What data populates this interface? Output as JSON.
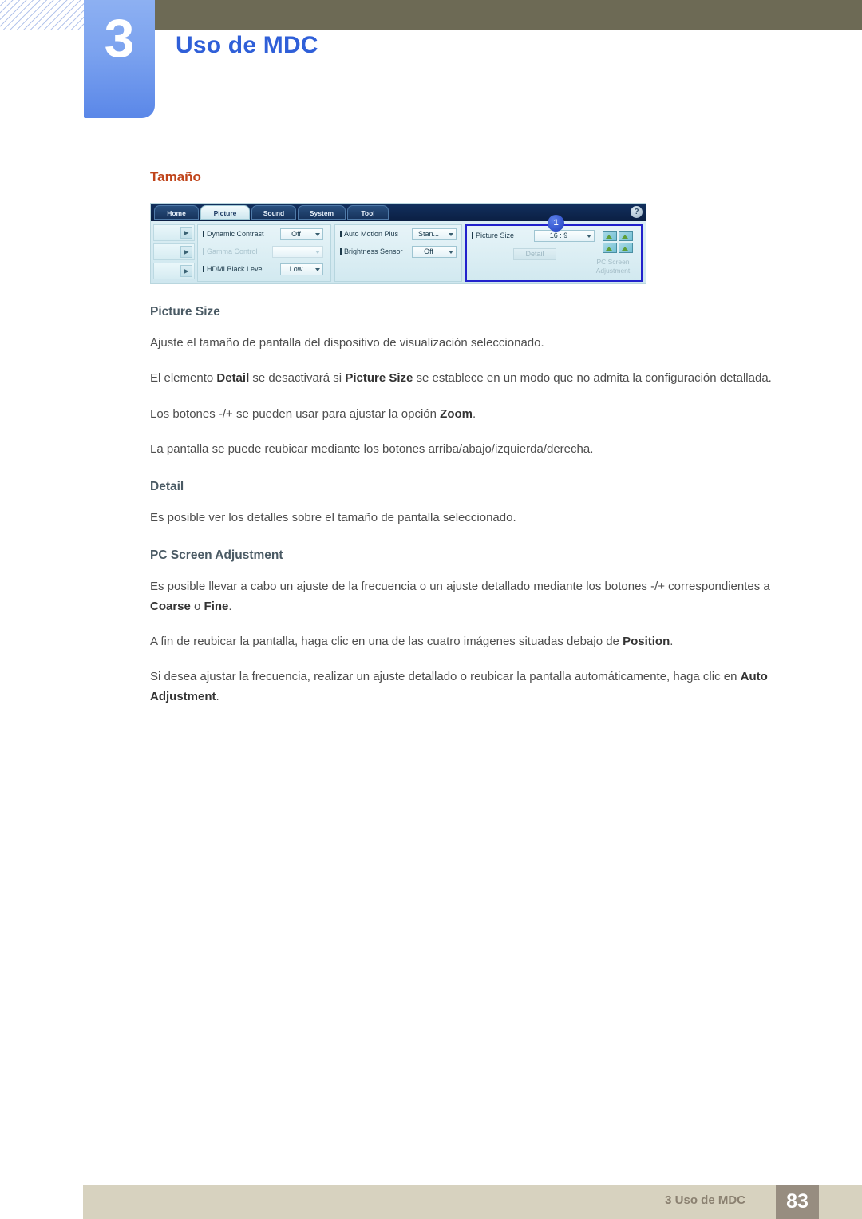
{
  "header": {
    "chapter_number": "3",
    "chapter_title": "Uso de MDC"
  },
  "content": {
    "section_heading": "Tamaño",
    "blocks": [
      {
        "type": "subheading",
        "text": "Picture Size"
      },
      {
        "type": "paragraph",
        "text": "Ajuste el tamaño de pantalla del dispositivo de visualización seleccionado."
      },
      {
        "type": "paragraph_rich",
        "parts": [
          {
            "t": "El elemento ",
            "b": false
          },
          {
            "t": "Detail",
            "b": true
          },
          {
            "t": " se desactivará si ",
            "b": false
          },
          {
            "t": "Picture Size",
            "b": true
          },
          {
            "t": " se establece en un modo que no admita la configuración detallada.",
            "b": false
          }
        ]
      },
      {
        "type": "paragraph_rich",
        "parts": [
          {
            "t": "Los botones -/+ se pueden usar para ajustar la opción ",
            "b": false
          },
          {
            "t": "Zoom",
            "b": true
          },
          {
            "t": ".",
            "b": false
          }
        ]
      },
      {
        "type": "paragraph",
        "text": "La pantalla se puede reubicar mediante los botones arriba/abajo/izquierda/derecha."
      },
      {
        "type": "subheading",
        "text": "Detail"
      },
      {
        "type": "paragraph",
        "text": "Es posible ver los detalles sobre el tamaño de pantalla seleccionado."
      },
      {
        "type": "subheading",
        "text": "PC Screen Adjustment"
      },
      {
        "type": "paragraph_rich",
        "parts": [
          {
            "t": "Es posible llevar a cabo un ajuste de la frecuencia o un ajuste detallado mediante los botones -/+ correspondientes a ",
            "b": false
          },
          {
            "t": "Coarse",
            "b": true
          },
          {
            "t": " o ",
            "b": false
          },
          {
            "t": "Fine",
            "b": true
          },
          {
            "t": ".",
            "b": false
          }
        ]
      },
      {
        "type": "paragraph_rich",
        "parts": [
          {
            "t": "A fin de reubicar la pantalla, haga clic en una de las cuatro imágenes situadas debajo de ",
            "b": false
          },
          {
            "t": "Position",
            "b": true
          },
          {
            "t": ".",
            "b": false
          }
        ]
      },
      {
        "type": "paragraph_rich",
        "parts": [
          {
            "t": "Si desea ajustar la frecuencia, realizar un ajuste detallado o reubicar la pantalla automáticamente, haga clic en ",
            "b": false
          },
          {
            "t": "Auto Adjustment",
            "b": true
          },
          {
            "t": ".",
            "b": false
          }
        ]
      }
    ]
  },
  "mdc_screenshot": {
    "tabs": [
      {
        "label": "Home",
        "active": false
      },
      {
        "label": "Picture",
        "active": true
      },
      {
        "label": "Sound",
        "active": false
      },
      {
        "label": "System",
        "active": false
      },
      {
        "label": "Tool",
        "active": false
      }
    ],
    "help_icon": "?",
    "callout_badge": "1",
    "group1": [
      {
        "label": "Dynamic Contrast",
        "value": "Off",
        "disabled": false
      },
      {
        "label": "Gamma Control",
        "value": "",
        "disabled": true
      },
      {
        "label": "HDMI Black Level",
        "value": "Low",
        "disabled": false
      }
    ],
    "group2": [
      {
        "label": "Auto Motion Plus",
        "value": "Stan...",
        "disabled": false
      },
      {
        "label": "Brightness Sensor",
        "value": "Off",
        "disabled": false
      }
    ],
    "group3": {
      "picture_size_label": "Picture Size",
      "picture_size_value": "16 : 9",
      "detail_button": "Detail",
      "pc_screen_adjustment": "PC Screen\nAdjustment"
    }
  },
  "footer": {
    "label": "3 Uso de MDC",
    "page_number": "83"
  }
}
